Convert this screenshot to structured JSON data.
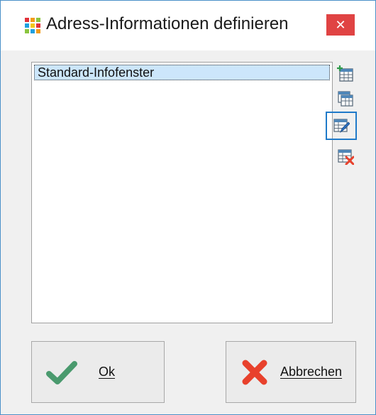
{
  "window": {
    "title": "Adress-Informationen definieren",
    "close_symbol": "✕",
    "icon": "app-grid-icon"
  },
  "list": {
    "items": [
      {
        "label": "Standard-Infofenster",
        "selected": true
      }
    ]
  },
  "side_toolbar": [
    {
      "icon": "add-table-icon",
      "selected": false
    },
    {
      "icon": "copy-table-icon",
      "selected": false
    },
    {
      "icon": "edit-table-icon",
      "selected": true
    },
    {
      "icon": "delete-table-icon",
      "selected": false
    }
  ],
  "buttons": {
    "ok_label": "Ok",
    "cancel_label": "Abbrechen"
  },
  "colors": {
    "accent": "#1f7ac9",
    "close": "#e04343",
    "selection": "#cce6fb",
    "check_green": "#4a9a6e",
    "cross_red": "#e8412c"
  }
}
